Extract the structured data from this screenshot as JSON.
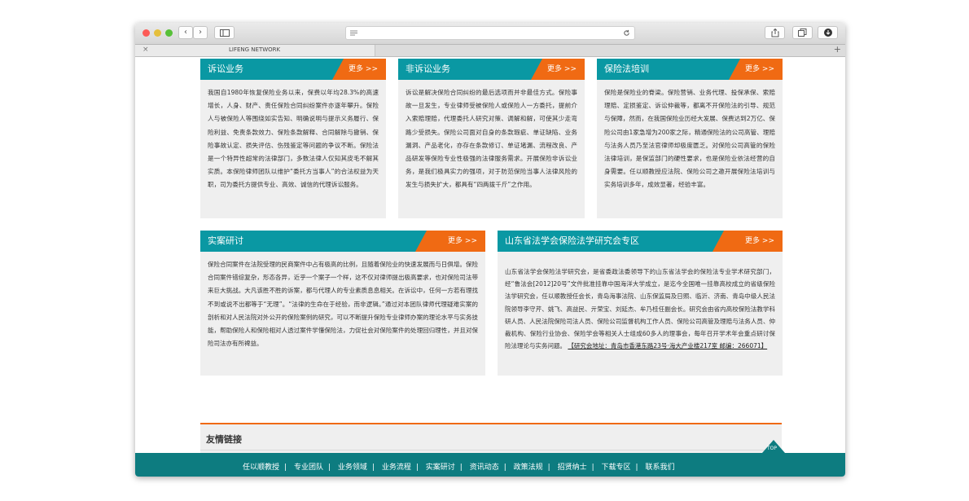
{
  "browser": {
    "tab_title": "LIFENG NETWORK",
    "tab_close": "×",
    "new_tab": "+"
  },
  "cards": [
    {
      "title": "诉讼业务",
      "more": "更多 >>",
      "body": "我国自1980年恢复保险业务以来，保费以年均28.3%的高速增长，人身、财产、责任保险合同纠纷案件亦逐年攀升。保险人与被保险人等围绕如实告知、明确说明与提示义务履行、保险利益、免责条款效力、保险条款解释、合同解除与撤销、保险事故认定、损失评估、伤残鉴定等问题的争议不断。保险法是一个特异性超常的法律部门，多数法律人仅知其皮毛不解其实质。本保险律师团队以维护“委托方当事人”的合法权益为天职，司为委托方提供专业、高效、诚信的代理诉讼服务。"
    },
    {
      "title": "非诉讼业务",
      "more": "更多 >>",
      "body": "诉讼是解决保险合同纠纷的最后选项而并非最佳方式。保险事故一旦发生，专业律师受被保险人或保险人一方委托，提前介入索赔理赔，代理委托人研究对策、调解和解，可使其少走弯路少受损失。保险公司面对自身的条款瑕疵、单证缺陷、业务漏洞、产品老化，亦存在条款修订、单证堵漏、流程改良、产品研发等保险专业性极强的法律服务需求。开展保险非诉讼业务，是我们极具实力的强项，对于防范保险当事人法律风险的发生与损失扩大，都具有“四两拨千斤”之作用。"
    },
    {
      "title": "保险法培训",
      "more": "更多 >>",
      "body": "保险是保险业的脊梁。保险营销、业务代理、投保承保、索赔理赔、定损鉴定、诉讼仲裁等，都离不开保险法的引导、规范与保障，然而，在我国保险业历经大发展、保费达到2万亿、保险公司由1家急增为200家之际，精通保险法的公司高管、理赔与法务人员乃至法官律师却极度匮乏。对保险公司高管的保险法律培训，是保监部门的硬性要求，也是保险业依法经营的自身需要。任以顺教授应法院、保险公司之邀开展保险法培训与实务培训多年，成效显著，经验丰富。"
    },
    {
      "title": "实案研讨",
      "more": "更多 >>",
      "body": "保险合同案件在法院受理的民商案件中占有极高的比例，且随着保险业的快速发展而与日俱增。保险合同案件错综复杂，形态各异，近乎一个案子一个样，这不仅对律师提出极高要求，也对保险司法带来巨大挑战。大凡该胜不胜的诉案，都与代理人的专业素质息息相关。在诉讼中，任何一方若有理找不到或说不出都等于“无理”。“法律的生命在于经验，而非逻辑。”通过对本团队律师代理疑难实案的剖析和对人民法院对外公开的保险案例的研究，可以不断提升保险专业律师办案的理论水平与实务技能，帮助保险人和保险相对人透过案件学懂保险法，力促社会对保险案件的处理回归理性，并且对保险司法亦有所裨益。"
    },
    {
      "title": "山东省法学会保险法学研究会专区",
      "more": "更多 >>",
      "body": "山东省法学会保险法学研究会，是省委政法委领导下的山东省法学会的保险法专业学术研究部门，经“鲁法会[2012]20号”文件批准挂靠中国海洋大学成立，是迄今全国唯一挂靠高校成立的省级保险法学研究会，任以顺教授任会长，青岛海事法院、山东保监局及日照、临沂、济南、青岛中级人民法院领导李守芹、姚飞、高益民、亓荣宝、刘延杰、牟乃桂任副会长。研究会由省内高校保险法教学科研人员、人民法院保险司法人员、保险公司监督机构工作人员、保险公司高管及理赔与法务人员、仲裁机构、保险行业协会、保险学会等相关人士组成60多人的理事会，每年召开学术年会重点研讨保险法理论与实务问题。",
      "address": "【研究会地址：青岛市香港东路23号·海大产业楼217室   邮编：266071】"
    }
  ],
  "friend_links": {
    "title": "友情链接"
  },
  "footer": {
    "top_label": "TOP",
    "nav": [
      "任以顺教授",
      "专业团队",
      "业务领域",
      "业务流程",
      "实案研讨",
      "资讯动态",
      "政策法规",
      "招贤纳士",
      "下载专区",
      "联系我们"
    ]
  },
  "colors": {
    "teal": "#0a98a3",
    "orange": "#f06a13",
    "footer": "#0d7c80",
    "card_bg": "#efefef"
  }
}
